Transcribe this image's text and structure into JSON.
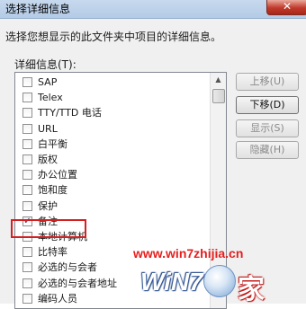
{
  "window": {
    "title": "选择详细信息",
    "close_glyph": "✕"
  },
  "description": "选择您想显示的此文件夹中项目的详细信息。",
  "list_label": "详细信息(T):",
  "items": [
    {
      "label": "SAP",
      "checked": false
    },
    {
      "label": "Telex",
      "checked": false
    },
    {
      "label": "TTY/TTD 电话",
      "checked": false
    },
    {
      "label": "URL",
      "checked": false
    },
    {
      "label": "白平衡",
      "checked": false
    },
    {
      "label": "版权",
      "checked": false
    },
    {
      "label": "办公位置",
      "checked": false
    },
    {
      "label": "饱和度",
      "checked": false
    },
    {
      "label": "保护",
      "checked": false
    },
    {
      "label": "备注",
      "checked": true
    },
    {
      "label": "本地计算机",
      "checked": false
    },
    {
      "label": "比特率",
      "checked": false
    },
    {
      "label": "必选的与会者",
      "checked": false
    },
    {
      "label": "必选的与会者地址",
      "checked": false
    },
    {
      "label": "编码人员",
      "checked": false
    }
  ],
  "buttons": {
    "move_up": "上移(U)",
    "move_down": "下移(D)",
    "show": "显示(S)",
    "hide": "隐藏(H)"
  },
  "watermark": {
    "url": "www.win7zhijia.cn",
    "logo_text": "WiN7",
    "jia": "家"
  },
  "colors": {
    "highlight": "#d42020",
    "titlebar": "#b9cfe8"
  }
}
